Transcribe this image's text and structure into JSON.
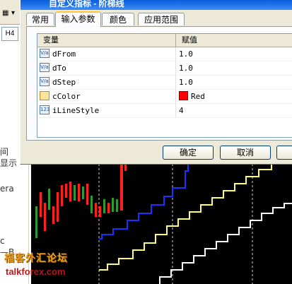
{
  "background_app": {
    "h4_label": "H4",
    "side_fragments": [
      "间",
      "显示",
      "era",
      "c",
      "—B"
    ]
  },
  "dialog": {
    "title": "自定义指标 - 阶梯线",
    "tabs": [
      {
        "label": "常用",
        "active": false
      },
      {
        "label": "输入参数",
        "active": true
      },
      {
        "label": "颜色",
        "active": false
      },
      {
        "label": "应用范围",
        "active": false
      }
    ],
    "grid": {
      "col_variable": "变量",
      "col_value": "赋值",
      "rows": [
        {
          "icon": "V/a",
          "icon_name": "double-variable-icon",
          "name": "dFrom",
          "value": "1.0"
        },
        {
          "icon": "V/a",
          "icon_name": "double-variable-icon",
          "name": "dTo",
          "value": "1.0"
        },
        {
          "icon": "V/a",
          "icon_name": "double-variable-icon",
          "name": "dStep",
          "value": "1.0"
        },
        {
          "icon": "",
          "icon_name": "color-variable-icon",
          "name": "cColor",
          "value": "Red",
          "swatch": "#ff0000"
        },
        {
          "icon": "123",
          "icon_name": "integer-variable-icon",
          "name": "iLineStyle",
          "value": "4"
        }
      ]
    },
    "buttons": {
      "ok": "确定",
      "cancel": "取消",
      "reset": "重置"
    }
  },
  "watermark": {
    "cn": "福客外汇论坛",
    "en": "talkforex.com"
  },
  "colors": {
    "accent_title": "#0a5ede",
    "dialog_bg": "#ece9d8",
    "chart_bg": "#000000",
    "line_blue": "#1f2fff",
    "line_yellow": "#ffff66",
    "line_white": "#ffffff",
    "candle_up": "#2e9b2e",
    "candle_down": "#ff2020"
  }
}
